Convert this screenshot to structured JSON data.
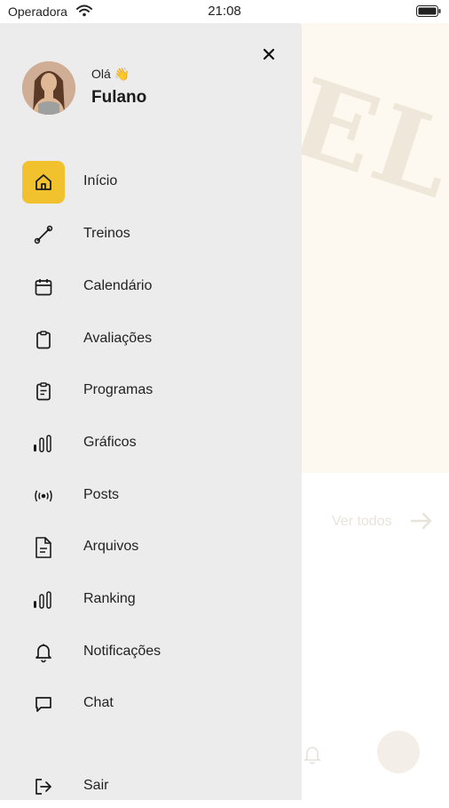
{
  "status_bar": {
    "carrier": "Operadora",
    "time": "21:08"
  },
  "user": {
    "greeting": "Olá 👋",
    "name": "Fulano"
  },
  "menu": {
    "items": [
      {
        "label": "Início",
        "icon": "home-icon",
        "active": true
      },
      {
        "label": "Treinos",
        "icon": "dumbbell-icon"
      },
      {
        "label": "Calendário",
        "icon": "calendar-icon"
      },
      {
        "label": "Avaliações",
        "icon": "clipboard-icon"
      },
      {
        "label": "Programas",
        "icon": "clipboard-list-icon"
      },
      {
        "label": "Gráficos",
        "icon": "bar-chart-icon"
      },
      {
        "label": "Posts",
        "icon": "broadcast-icon"
      },
      {
        "label": "Arquivos",
        "icon": "file-icon"
      },
      {
        "label": "Ranking",
        "icon": "ranking-chart-icon"
      },
      {
        "label": "Notificações",
        "icon": "bell-icon"
      },
      {
        "label": "Chat",
        "icon": "chat-bubble-icon"
      }
    ],
    "logout_label": "Sair"
  },
  "background": {
    "see_all_label": "Ver todos"
  },
  "colors": {
    "accent": "#f2c12e",
    "drawer_bg": "#ececec"
  }
}
